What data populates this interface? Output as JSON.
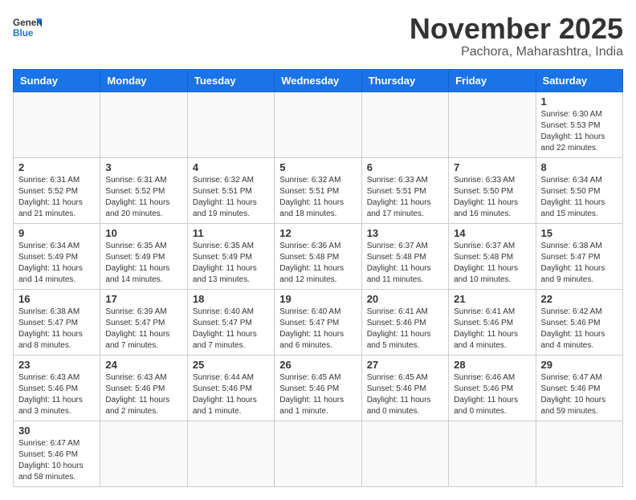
{
  "header": {
    "logo_general": "General",
    "logo_blue": "Blue",
    "month": "November 2025",
    "location": "Pachora, Maharashtra, India"
  },
  "weekdays": [
    "Sunday",
    "Monday",
    "Tuesday",
    "Wednesday",
    "Thursday",
    "Friday",
    "Saturday"
  ],
  "weeks": [
    [
      {
        "day": "",
        "info": ""
      },
      {
        "day": "",
        "info": ""
      },
      {
        "day": "",
        "info": ""
      },
      {
        "day": "",
        "info": ""
      },
      {
        "day": "",
        "info": ""
      },
      {
        "day": "",
        "info": ""
      },
      {
        "day": "1",
        "info": "Sunrise: 6:30 AM\nSunset: 5:53 PM\nDaylight: 11 hours\nand 22 minutes."
      }
    ],
    [
      {
        "day": "2",
        "info": "Sunrise: 6:31 AM\nSunset: 5:52 PM\nDaylight: 11 hours\nand 21 minutes."
      },
      {
        "day": "3",
        "info": "Sunrise: 6:31 AM\nSunset: 5:52 PM\nDaylight: 11 hours\nand 20 minutes."
      },
      {
        "day": "4",
        "info": "Sunrise: 6:32 AM\nSunset: 5:51 PM\nDaylight: 11 hours\nand 19 minutes."
      },
      {
        "day": "5",
        "info": "Sunrise: 6:32 AM\nSunset: 5:51 PM\nDaylight: 11 hours\nand 18 minutes."
      },
      {
        "day": "6",
        "info": "Sunrise: 6:33 AM\nSunset: 5:51 PM\nDaylight: 11 hours\nand 17 minutes."
      },
      {
        "day": "7",
        "info": "Sunrise: 6:33 AM\nSunset: 5:50 PM\nDaylight: 11 hours\nand 16 minutes."
      },
      {
        "day": "8",
        "info": "Sunrise: 6:34 AM\nSunset: 5:50 PM\nDaylight: 11 hours\nand 15 minutes."
      }
    ],
    [
      {
        "day": "9",
        "info": "Sunrise: 6:34 AM\nSunset: 5:49 PM\nDaylight: 11 hours\nand 14 minutes."
      },
      {
        "day": "10",
        "info": "Sunrise: 6:35 AM\nSunset: 5:49 PM\nDaylight: 11 hours\nand 14 minutes."
      },
      {
        "day": "11",
        "info": "Sunrise: 6:35 AM\nSunset: 5:49 PM\nDaylight: 11 hours\nand 13 minutes."
      },
      {
        "day": "12",
        "info": "Sunrise: 6:36 AM\nSunset: 5:48 PM\nDaylight: 11 hours\nand 12 minutes."
      },
      {
        "day": "13",
        "info": "Sunrise: 6:37 AM\nSunset: 5:48 PM\nDaylight: 11 hours\nand 11 minutes."
      },
      {
        "day": "14",
        "info": "Sunrise: 6:37 AM\nSunset: 5:48 PM\nDaylight: 11 hours\nand 10 minutes."
      },
      {
        "day": "15",
        "info": "Sunrise: 6:38 AM\nSunset: 5:47 PM\nDaylight: 11 hours\nand 9 minutes."
      }
    ],
    [
      {
        "day": "16",
        "info": "Sunrise: 6:38 AM\nSunset: 5:47 PM\nDaylight: 11 hours\nand 8 minutes."
      },
      {
        "day": "17",
        "info": "Sunrise: 6:39 AM\nSunset: 5:47 PM\nDaylight: 11 hours\nand 7 minutes."
      },
      {
        "day": "18",
        "info": "Sunrise: 6:40 AM\nSunset: 5:47 PM\nDaylight: 11 hours\nand 7 minutes."
      },
      {
        "day": "19",
        "info": "Sunrise: 6:40 AM\nSunset: 5:47 PM\nDaylight: 11 hours\nand 6 minutes."
      },
      {
        "day": "20",
        "info": "Sunrise: 6:41 AM\nSunset: 5:46 PM\nDaylight: 11 hours\nand 5 minutes."
      },
      {
        "day": "21",
        "info": "Sunrise: 6:41 AM\nSunset: 5:46 PM\nDaylight: 11 hours\nand 4 minutes."
      },
      {
        "day": "22",
        "info": "Sunrise: 6:42 AM\nSunset: 5:46 PM\nDaylight: 11 hours\nand 4 minutes."
      }
    ],
    [
      {
        "day": "23",
        "info": "Sunrise: 6:43 AM\nSunset: 5:46 PM\nDaylight: 11 hours\nand 3 minutes."
      },
      {
        "day": "24",
        "info": "Sunrise: 6:43 AM\nSunset: 5:46 PM\nDaylight: 11 hours\nand 2 minutes."
      },
      {
        "day": "25",
        "info": "Sunrise: 6:44 AM\nSunset: 5:46 PM\nDaylight: 11 hours\nand 1 minute."
      },
      {
        "day": "26",
        "info": "Sunrise: 6:45 AM\nSunset: 5:46 PM\nDaylight: 11 hours\nand 1 minute."
      },
      {
        "day": "27",
        "info": "Sunrise: 6:45 AM\nSunset: 5:46 PM\nDaylight: 11 hours\nand 0 minutes."
      },
      {
        "day": "28",
        "info": "Sunrise: 6:46 AM\nSunset: 5:46 PM\nDaylight: 11 hours\nand 0 minutes."
      },
      {
        "day": "29",
        "info": "Sunrise: 6:47 AM\nSunset: 5:46 PM\nDaylight: 10 hours\nand 59 minutes."
      }
    ],
    [
      {
        "day": "30",
        "info": "Sunrise: 6:47 AM\nSunset: 5:46 PM\nDaylight: 10 hours\nand 58 minutes."
      },
      {
        "day": "",
        "info": ""
      },
      {
        "day": "",
        "info": ""
      },
      {
        "day": "",
        "info": ""
      },
      {
        "day": "",
        "info": ""
      },
      {
        "day": "",
        "info": ""
      },
      {
        "day": "",
        "info": ""
      }
    ]
  ]
}
